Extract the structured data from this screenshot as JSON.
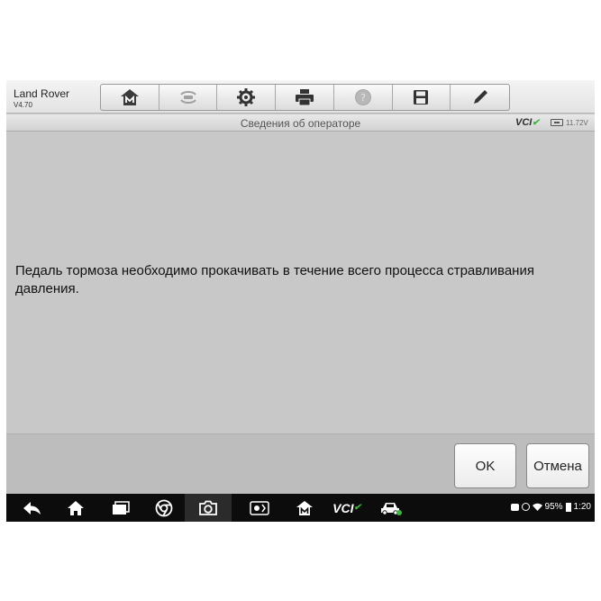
{
  "header": {
    "title": "Land Rover",
    "version": "V4.70"
  },
  "toolbar": {
    "buttons": [
      {
        "icon": "home-m-icon",
        "enabled": true
      },
      {
        "icon": "vehicle-swap-icon",
        "enabled": false
      },
      {
        "icon": "gear-icon",
        "enabled": true
      },
      {
        "icon": "printer-icon",
        "enabled": true
      },
      {
        "icon": "help-icon",
        "enabled": false
      },
      {
        "icon": "save-icon",
        "enabled": true
      },
      {
        "icon": "pen-icon",
        "enabled": true
      }
    ]
  },
  "titlebar": {
    "title": "Сведения об операторе",
    "vci": "VCI",
    "voltage": "11.72V"
  },
  "message": {
    "text": "Педаль тормоза необходимо прокачивать в течение всего процесса стравливания давления."
  },
  "actions": {
    "ok_label": "OK",
    "cancel_label": "Отмена"
  },
  "navbar": {
    "vci_label": "VCI",
    "battery_percent": "95%",
    "time": "1:20"
  },
  "colors": {
    "background": "#c8c8c8",
    "navbar": "#0c0c0c",
    "vci_ok": "#3fb53f"
  }
}
